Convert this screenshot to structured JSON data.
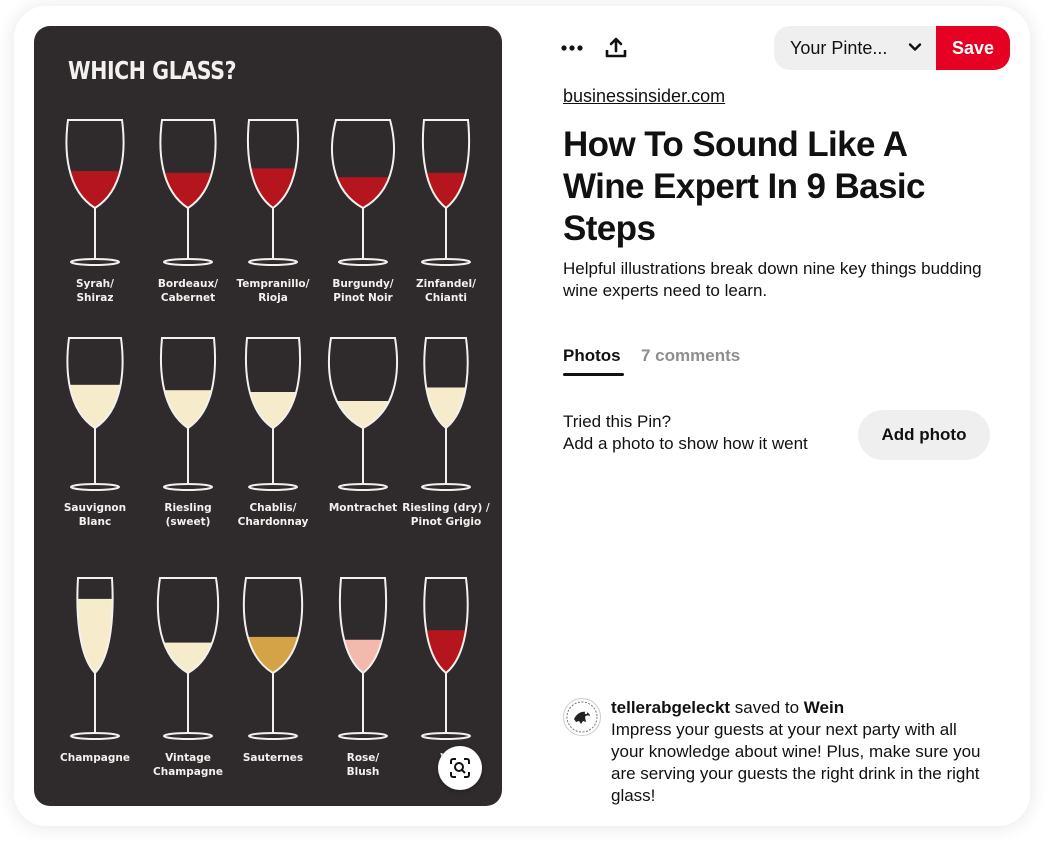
{
  "pin": {
    "poster": {
      "title": "WHICH GLASS?",
      "glasses": [
        {
          "label": "Syrah/\nShiraz",
          "wine": "red"
        },
        {
          "label": "Bordeaux/\nCabernet",
          "wine": "red"
        },
        {
          "label": "Tempranillo/\nRioja",
          "wine": "red"
        },
        {
          "label": "Burgundy/\nPinot Noir",
          "wine": "red"
        },
        {
          "label": "Zinfandel/\nChianti",
          "wine": "red"
        },
        {
          "label": "Sauvignon\nBlanc",
          "wine": "white"
        },
        {
          "label": "Riesling\n(sweet)",
          "wine": "white"
        },
        {
          "label": "Chablis/\nChardonnay",
          "wine": "white"
        },
        {
          "label": "Montrachet",
          "wine": "white"
        },
        {
          "label": "Riesling (dry) /\nPinot Grigio",
          "wine": "white"
        },
        {
          "label": "Champagne",
          "wine": "white"
        },
        {
          "label": "Vintage\nChampagne",
          "wine": "white"
        },
        {
          "label": "Sauternes",
          "wine": "gold"
        },
        {
          "label": "Rose/\nBlush",
          "wine": "rose"
        },
        {
          "label": "Vi",
          "wine": "red"
        }
      ],
      "colors": {
        "background": "#2f2a2c",
        "red": "#b5161e",
        "white": "#f6eccb",
        "gold": "#d4a247",
        "rose": "#f2b9ac",
        "outline": "#f3f1ee"
      }
    },
    "lens_icon": "visual-search-icon"
  },
  "toolbar": {
    "more_icon": "more-options-icon",
    "share_icon": "share-icon",
    "board_select": "Your Pinte...",
    "save_label": "Save"
  },
  "details": {
    "source": "businessinsider.com",
    "title": "How To Sound Like A Wine Expert In 9 Basic Steps",
    "description": "Helpful illustrations break down nine key things budding wine experts need to learn.",
    "tabs": [
      "Photos",
      "7 comments"
    ],
    "tried": {
      "title": "Tried this Pin?",
      "subtitle": "Add a photo to show how it went",
      "button": "Add photo"
    },
    "saved_by": {
      "user": "tellerabgeleckt",
      "middle": "saved to",
      "board": "Wein",
      "note": "Impress your guests at your next party with all your knowledge about wine! Plus, make sure you are serving your guests the right drink in the right glass!"
    }
  },
  "colors": {
    "accent": "#e60023",
    "button_bg": "#efefef",
    "muted": "#8e8e8e"
  }
}
